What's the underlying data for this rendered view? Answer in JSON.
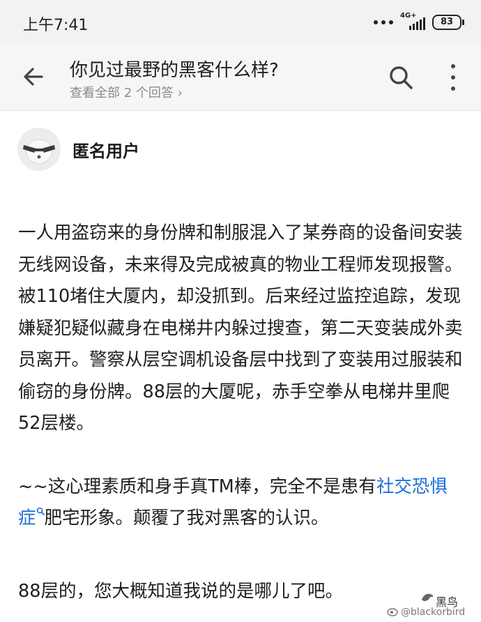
{
  "status_bar": {
    "time": "上午7:41",
    "network": "4G+",
    "battery": "83"
  },
  "header": {
    "title": "你见过最野的黑客什么样?",
    "subtitle": "查看全部 2 个回答 ›"
  },
  "answer": {
    "author": "匿名用户",
    "paragraph1": "一人用盗窃来的身份牌和制服混入了某券商的设备间安装无线网设备，未来得及完成被真的物业工程师发现报警。被110堵住大厦内，却没抓到。后来经过监控追踪，发现嫌疑犯疑似藏身在电梯井内躲过搜查，第二天变装成外卖员离开。警察从层空调机设备层中找到了变装用过服装和偷窃的身份牌。88层的大厦呢，赤手空拳从电梯井里爬52层楼。",
    "paragraph2_before": "~~这心理素质和身手真TM棒，完全不是患有",
    "paragraph2_link": "社交恐惧症",
    "paragraph2_after": "肥宅形象。颠覆了我对黑客的认识。",
    "paragraph3": "88层的，您大概知道我说的是哪儿了吧。"
  },
  "watermark": {
    "name": "黑鸟",
    "handle": "@blackorbird"
  },
  "colors": {
    "link": "#1e6fd9",
    "status_bg": "#f2f2f2",
    "header_bg": "#f6f6f6"
  }
}
